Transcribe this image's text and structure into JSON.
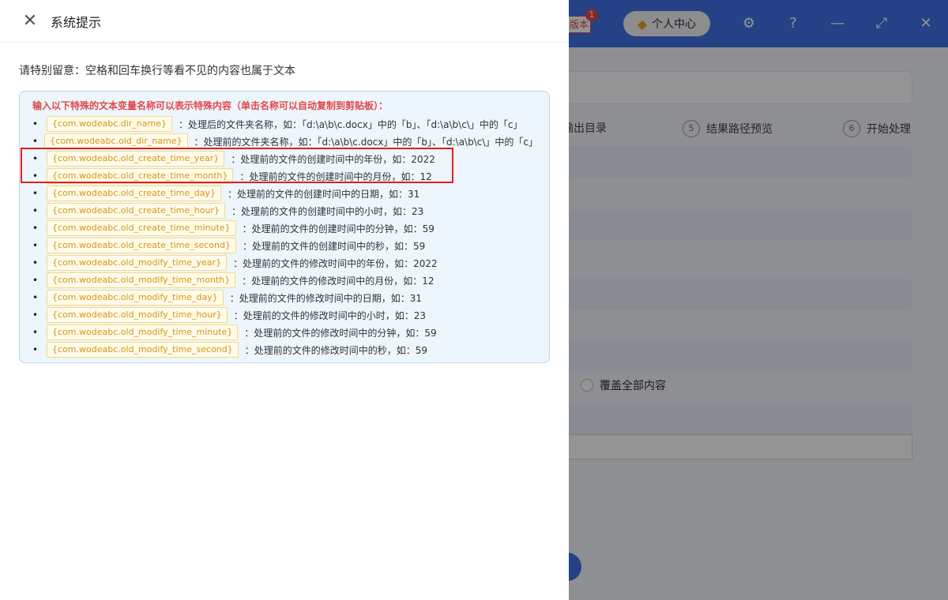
{
  "drawer": {
    "title": "系统提示",
    "close_icon": "close-icon",
    "notice": "请特别留意：空格和回车换行等看不见的内容也属于文本",
    "info_heading": "输入以下特殊的文本变量名称可以表示特殊内容（单击名称可以自动复制到剪贴板）：",
    "variables": [
      {
        "name": "{com.wodeabc.dir_name}",
        "desc": "：处理后的文件夹名称，如：「d:\\a\\b\\c.docx」中的「b」、「d:\\a\\b\\c\\」中的「c」"
      },
      {
        "name": "{com.wodeabc.old_dir_name}",
        "desc": "：处理前的文件夹名称，如：「d:\\a\\b\\c.docx」中的「b」、「d:\\a\\b\\c\\」中的「c」"
      },
      {
        "name": "{com.wodeabc.old_create_time_year}",
        "desc": "：处理前的文件的创建时间中的年份，如：2022"
      },
      {
        "name": "{com.wodeabc.old_create_time_month}",
        "desc": "：处理前的文件的创建时间中的月份，如：12"
      },
      {
        "name": "{com.wodeabc.old_create_time_day}",
        "desc": "：处理前的文件的创建时间中的日期，如：31"
      },
      {
        "name": "{com.wodeabc.old_create_time_hour}",
        "desc": "：处理前的文件的创建时间中的小时，如：23"
      },
      {
        "name": "{com.wodeabc.old_create_time_minute}",
        "desc": "：处理前的文件的创建时间中的分钟，如：59"
      },
      {
        "name": "{com.wodeabc.old_create_time_second}",
        "desc": "：处理前的文件的创建时间中的秒，如：59"
      },
      {
        "name": "{com.wodeabc.old_modify_time_year}",
        "desc": "：处理前的文件的修改时间中的年份，如：2022"
      },
      {
        "name": "{com.wodeabc.old_modify_time_month}",
        "desc": "：处理前的文件的修改时间中的月份，如：12"
      },
      {
        "name": "{com.wodeabc.old_modify_time_day}",
        "desc": "：处理前的文件的修改时间中的日期，如：31"
      },
      {
        "name": "{com.wodeabc.old_modify_time_hour}",
        "desc": "：处理前的文件的修改时间中的小时，如：23"
      },
      {
        "name": "{com.wodeabc.old_modify_time_minute}",
        "desc": "：处理前的文件的修改时间中的分钟，如：59"
      },
      {
        "name": "{com.wodeabc.old_modify_time_second}",
        "desc": "：处理前的文件的修改时间中的秒，如：59"
      }
    ]
  },
  "background": {
    "badge_label": "版本",
    "badge_count": "1",
    "personal_center": "个人中心",
    "personal_icon": "diamond-icon",
    "settings_icon": "gear-icon",
    "help_icon": "help-icon",
    "minimize_icon": "minimize-icon",
    "maximize_icon": "maximize-icon",
    "window_close_icon": "close-icon",
    "steps": [
      {
        "num": "",
        "label": "输出目录"
      },
      {
        "num": "5",
        "label": "结果路径预览"
      },
      {
        "num": "6",
        "label": "开始处理"
      }
    ],
    "radio_label": "覆盖全部内容"
  },
  "colors": {
    "titlebar": "#3f73e6",
    "heading_red": "#e04848",
    "tag_text": "#d4951c",
    "highlight": "#e02020"
  }
}
